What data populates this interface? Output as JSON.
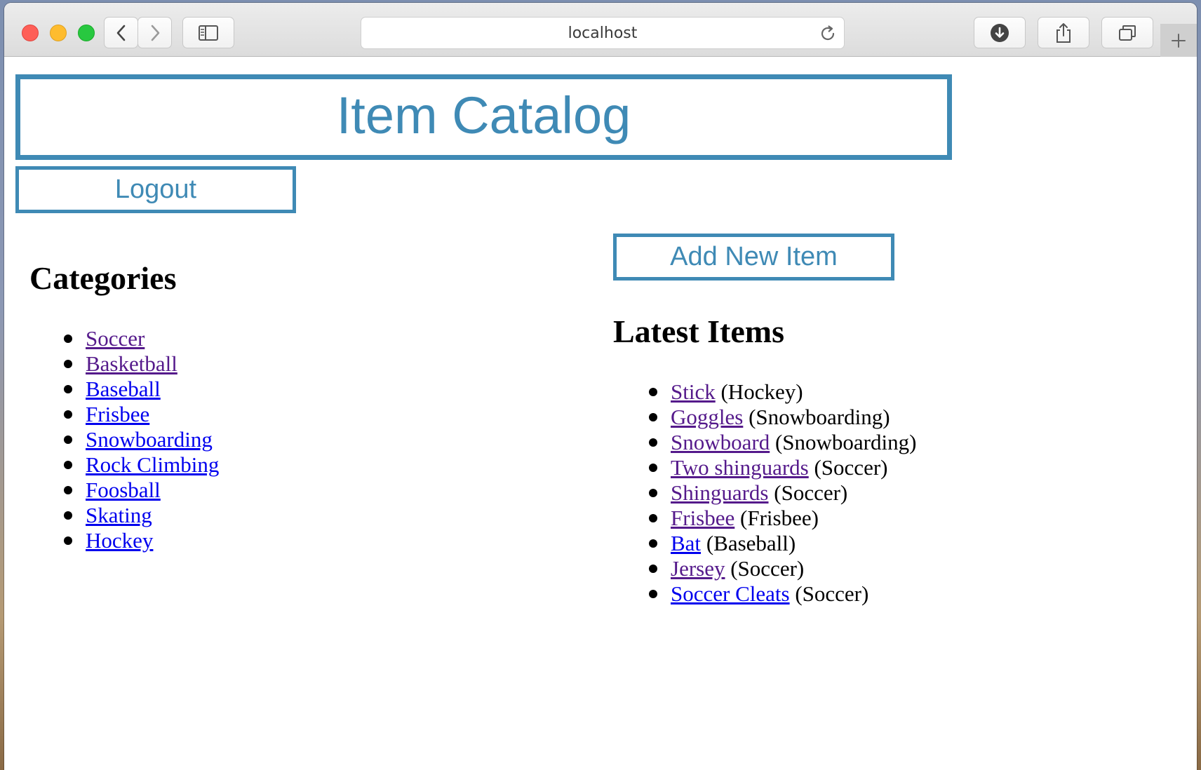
{
  "browser": {
    "url": "localhost"
  },
  "page": {
    "title": "Item Catalog",
    "logout_label": "Logout",
    "add_item_label": "Add New Item",
    "categories_heading": "Categories",
    "latest_heading": "Latest Items"
  },
  "colors": {
    "accent": "#3f8ab5",
    "link_visited": "#551a8b",
    "link_unvisited": "#0000ee"
  },
  "categories": [
    {
      "label": "Soccer",
      "visited": true
    },
    {
      "label": "Basketball",
      "visited": true
    },
    {
      "label": "Baseball",
      "visited": false
    },
    {
      "label": "Frisbee",
      "visited": false
    },
    {
      "label": "Snowboarding",
      "visited": false
    },
    {
      "label": "Rock Climbing",
      "visited": false
    },
    {
      "label": "Foosball",
      "visited": false
    },
    {
      "label": "Skating",
      "visited": false
    },
    {
      "label": "Hockey",
      "visited": false
    }
  ],
  "latest_items": [
    {
      "name": "Stick",
      "category": "(Hockey)",
      "visited": true
    },
    {
      "name": "Goggles",
      "category": "(Snowboarding)",
      "visited": true
    },
    {
      "name": "Snowboard",
      "category": "(Snowboarding)",
      "visited": true
    },
    {
      "name": "Two shinguards",
      "category": "(Soccer)",
      "visited": true
    },
    {
      "name": "Shinguards",
      "category": "(Soccer)",
      "visited": true
    },
    {
      "name": "Frisbee",
      "category": "(Frisbee)",
      "visited": true
    },
    {
      "name": "Bat",
      "category": "(Baseball)",
      "visited": false
    },
    {
      "name": "Jersey",
      "category": "(Soccer)",
      "visited": true
    },
    {
      "name": "Soccer Cleats",
      "category": "(Soccer)",
      "visited": false
    }
  ]
}
